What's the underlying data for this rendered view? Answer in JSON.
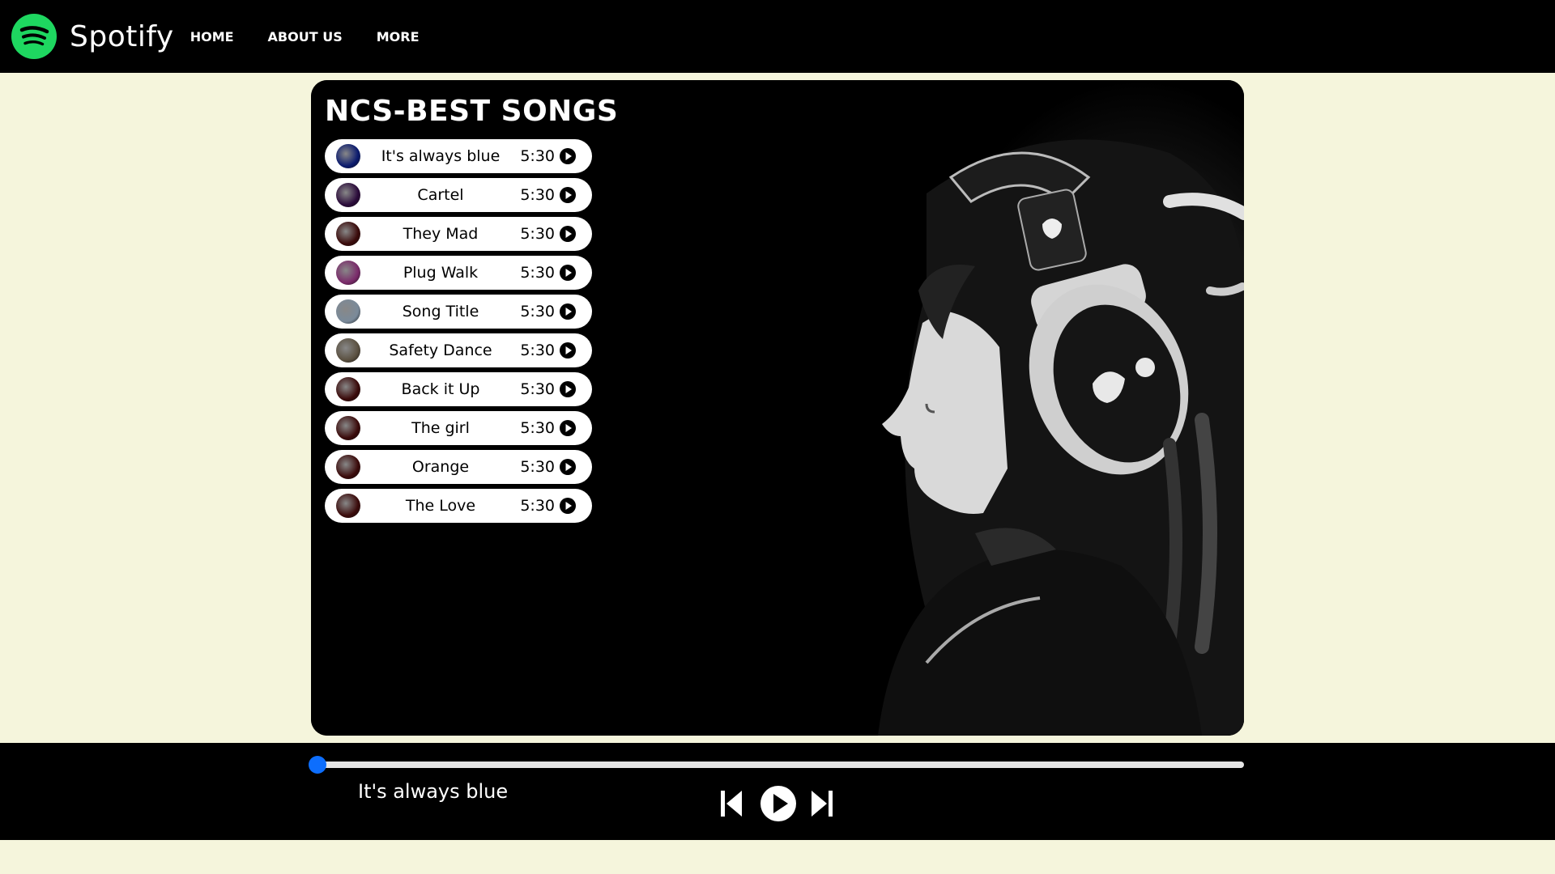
{
  "app": {
    "brand": "Spotify",
    "accent_color": "#1ed760"
  },
  "nav": {
    "items": [
      {
        "label": "HOME"
      },
      {
        "label": "ABOUT US"
      },
      {
        "label": "MORE"
      }
    ]
  },
  "main": {
    "title": "NCS-BEST SONGS",
    "songs": [
      {
        "name": "It's always blue",
        "duration": "5:30",
        "cover_color": "#0a1a6e"
      },
      {
        "name": "Cartel",
        "duration": "5:30",
        "cover_color": "#2a0a3a"
      },
      {
        "name": "They Mad",
        "duration": "5:30",
        "cover_color": "#3a0a0a"
      },
      {
        "name": "Plug Walk",
        "duration": "5:30",
        "cover_color": "#7a2a6a"
      },
      {
        "name": "Song Title",
        "duration": "5:30",
        "cover_color": "#7a8a9a"
      },
      {
        "name": "Safety Dance",
        "duration": "5:30",
        "cover_color": "#5a5040"
      },
      {
        "name": "Back it Up",
        "duration": "5:30",
        "cover_color": "#3a0a0a"
      },
      {
        "name": "The girl",
        "duration": "5:30",
        "cover_color": "#3a0a0a"
      },
      {
        "name": "Orange",
        "duration": "5:30",
        "cover_color": "#3a0a0a"
      },
      {
        "name": "The Love",
        "duration": "5:30",
        "cover_color": "#3a0a0a"
      }
    ]
  },
  "player": {
    "now_playing": "It's always blue",
    "progress_fraction": 0.0,
    "progress_color": "#0d6efd",
    "controls": [
      "skip-back-icon",
      "play-icon",
      "skip-forward-icon"
    ]
  }
}
